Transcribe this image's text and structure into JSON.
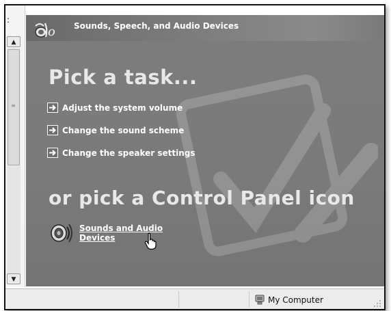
{
  "window": {
    "left_pane_fragment": ":"
  },
  "panel": {
    "header_title": "Sounds, Speech, and Audio Devices",
    "header_icon": "sounds-speech-category-icon",
    "pick_task_heading": "Pick a task...",
    "tasks": [
      {
        "label": "Adjust the system volume",
        "icon": "arrow-right-icon"
      },
      {
        "label": "Change the sound scheme",
        "icon": "arrow-right-icon"
      },
      {
        "label": "Change the speaker settings",
        "icon": "arrow-right-icon"
      }
    ],
    "or_pick_heading": "or pick a Control Panel icon",
    "control_panel_icons": [
      {
        "label": "Sounds and Audio Devices",
        "icon": "speaker-icon"
      }
    ]
  },
  "statusbar": {
    "location_label": "My Computer",
    "location_icon": "my-computer-icon"
  },
  "colors": {
    "panel_bg": "#7a7a7a",
    "heading_text": "#e8e8e8",
    "link_text": "#ffffff",
    "statusbar_bg": "#ececec"
  }
}
